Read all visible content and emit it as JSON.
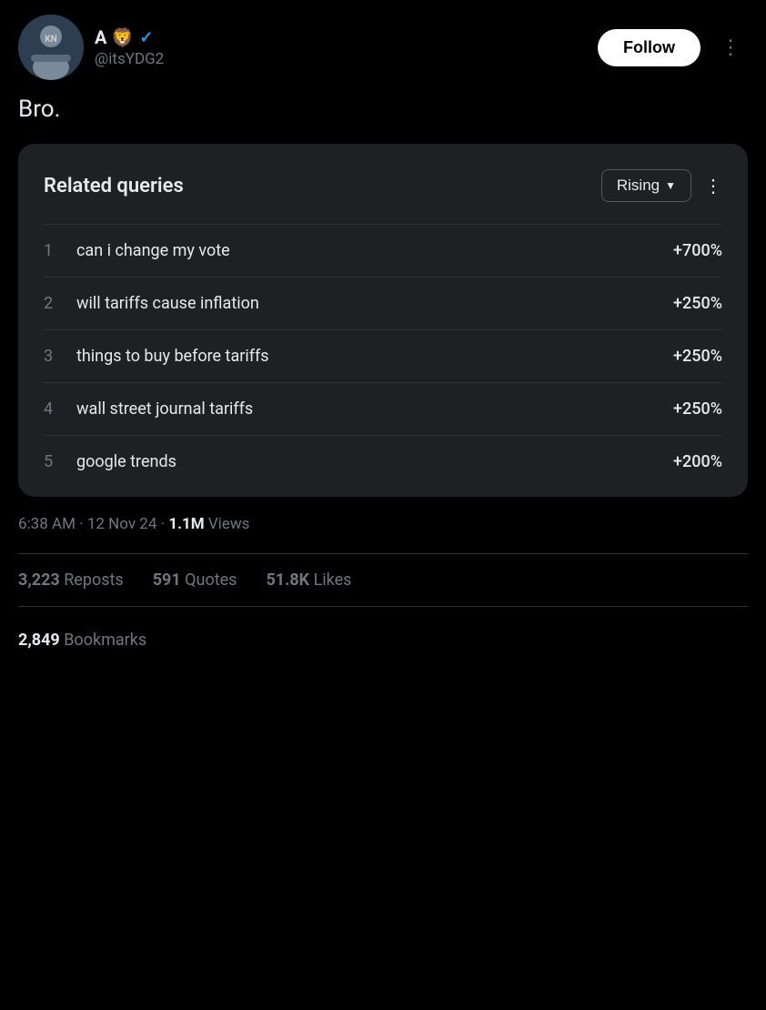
{
  "header": {
    "avatar_emoji": "👤",
    "display_name": "A 🦁",
    "verified": true,
    "username": "@itsYDG2",
    "follow_label": "Follow",
    "more_icon": "⋮"
  },
  "tweet": {
    "text": "Bro."
  },
  "trends_card": {
    "title": "Related queries",
    "filter_label": "Rising",
    "more_icon": "⋮",
    "rows": [
      {
        "num": "1",
        "query": "can i change my vote",
        "pct": "+700%"
      },
      {
        "num": "2",
        "query": "will tariffs cause inflation",
        "pct": "+250%"
      },
      {
        "num": "3",
        "query": "things to buy before tariffs",
        "pct": "+250%"
      },
      {
        "num": "4",
        "query": "wall street journal tariffs",
        "pct": "+250%"
      },
      {
        "num": "5",
        "query": "google trends",
        "pct": "+200%"
      }
    ]
  },
  "meta": {
    "time": "6:38 AM",
    "date": "12 Nov 24",
    "views": "1.1M",
    "views_label": "Views"
  },
  "stats": {
    "reposts_count": "3,223",
    "reposts_label": "Reposts",
    "quotes_count": "591",
    "quotes_label": "Quotes",
    "likes_count": "51.8K",
    "likes_label": "Likes"
  },
  "bookmarks": {
    "count": "2,849",
    "label": "Bookmarks"
  }
}
